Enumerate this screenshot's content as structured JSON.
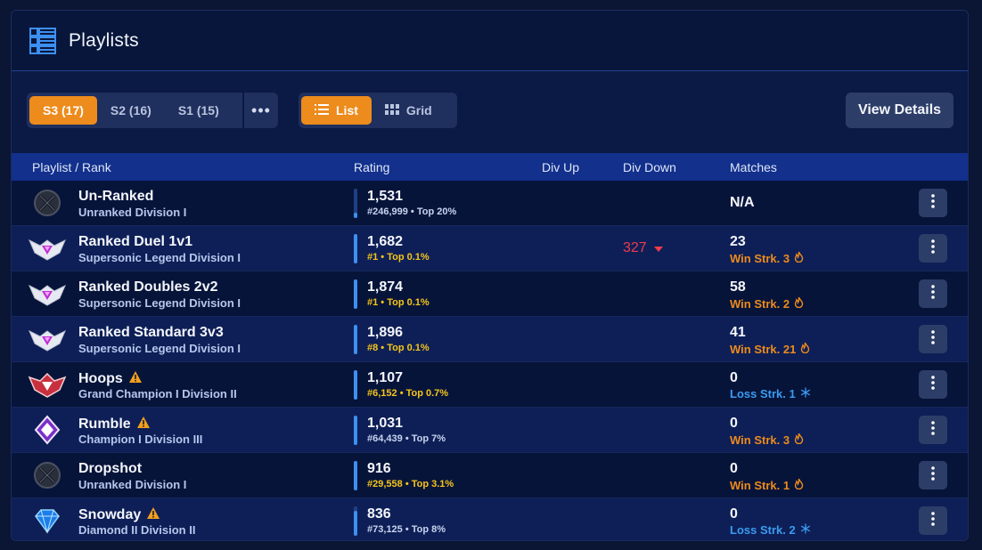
{
  "header": {
    "title": "Playlists",
    "icon": "playlist-icon"
  },
  "toolbar": {
    "seasons": [
      "S3 (17)",
      "S2 (16)",
      "S1 (15)"
    ],
    "active_season": 0,
    "more_label": "•••",
    "views": [
      "List",
      "Grid"
    ],
    "active_view": 0,
    "view_details_label": "View Details"
  },
  "table": {
    "columns": {
      "playlist": "Playlist / Rank",
      "rating": "Rating",
      "div_up": "Div Up",
      "div_down": "Div Down",
      "matches": "Matches"
    },
    "rows": [
      {
        "name": "Un-Ranked",
        "rank": "Unranked Division I",
        "icon": "unranked-icon",
        "warning": false,
        "rating": "1,531",
        "rating_sub": "#246,999 • Top 20%",
        "sub_tone": "lo",
        "progress": 0.18,
        "div_down": "",
        "matches": "N/A",
        "streak": "",
        "streak_type": ""
      },
      {
        "name": "Ranked Duel 1v1",
        "rank": "Supersonic Legend Division I",
        "icon": "supersonic-legend-icon",
        "warning": false,
        "rating": "1,682",
        "rating_sub": "#1 • Top 0.1%",
        "sub_tone": "hi",
        "progress": 1.0,
        "div_down": "327",
        "matches": "23",
        "streak": "Win Strk. 3",
        "streak_type": "win"
      },
      {
        "name": "Ranked Doubles 2v2",
        "rank": "Supersonic Legend Division I",
        "icon": "supersonic-legend-icon",
        "warning": false,
        "rating": "1,874",
        "rating_sub": "#1 • Top 0.1%",
        "sub_tone": "hi",
        "progress": 1.0,
        "div_down": "",
        "matches": "58",
        "streak": "Win Strk. 2",
        "streak_type": "win"
      },
      {
        "name": "Ranked Standard 3v3",
        "rank": "Supersonic Legend Division I",
        "icon": "supersonic-legend-icon",
        "warning": false,
        "rating": "1,896",
        "rating_sub": "#8 • Top 0.1%",
        "sub_tone": "hi",
        "progress": 1.0,
        "div_down": "",
        "matches": "41",
        "streak": "Win Strk. 21",
        "streak_type": "win"
      },
      {
        "name": "Hoops",
        "rank": "Grand Champion I Division II",
        "icon": "grand-champion-icon",
        "warning": true,
        "rating": "1,107",
        "rating_sub": "#6,152 • Top 0.7%",
        "sub_tone": "hi",
        "progress": 1.0,
        "div_down": "",
        "matches": "0",
        "streak": "Loss Strk. 1",
        "streak_type": "loss"
      },
      {
        "name": "Rumble",
        "rank": "Champion I Division III",
        "icon": "champion-icon",
        "warning": true,
        "rating": "1,031",
        "rating_sub": "#64,439 • Top 7%",
        "sub_tone": "lo",
        "progress": 1.0,
        "div_down": "",
        "matches": "0",
        "streak": "Win Strk. 3",
        "streak_type": "win"
      },
      {
        "name": "Dropshot",
        "rank": "Unranked Division I",
        "icon": "unranked-icon",
        "warning": false,
        "rating": "916",
        "rating_sub": "#29,558 • Top 3.1%",
        "sub_tone": "hi",
        "progress": 1.0,
        "div_down": "",
        "matches": "0",
        "streak": "Win Strk. 1",
        "streak_type": "win"
      },
      {
        "name": "Snowday",
        "rank": "Diamond II Division II",
        "icon": "diamond-icon",
        "warning": true,
        "rating": "836",
        "rating_sub": "#73,125 • Top 8%",
        "sub_tone": "lo",
        "progress": 0.85,
        "div_down": "",
        "matches": "0",
        "streak": "Loss Strk. 2",
        "streak_type": "loss"
      }
    ]
  },
  "colors": {
    "accent": "#ed8b1c",
    "win": "#ed8b1c",
    "loss": "#3b9bf0",
    "div_down": "#ef3b4d",
    "top_rank": "#f5c518"
  }
}
